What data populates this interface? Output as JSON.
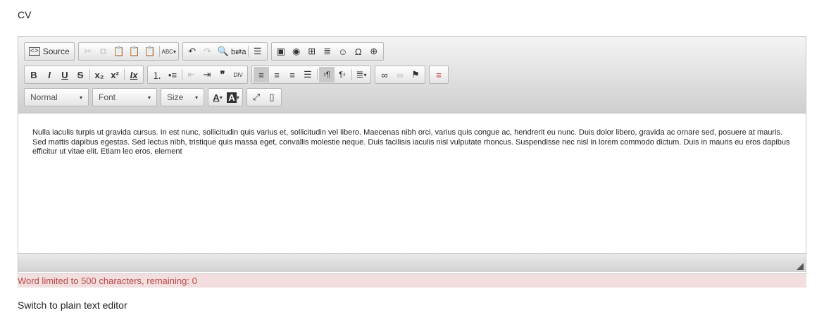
{
  "field_label": "CV",
  "toolbar": {
    "source_label": "Source",
    "style_combo": "Normal",
    "font_combo": "Font",
    "size_combo": "Size",
    "spell_label": "ABC",
    "div_label": "DIV"
  },
  "editor_text": "Nulla iaculis turpis ut gravida cursus. In est nunc, sollicitudin quis varius et, sollicitudin vel libero. Maecenas nibh orci, varius quis congue ac, hendrerit eu nunc. Duis dolor libero, gravida ac ornare sed, posuere at mauris. Sed mattis dapibus egestas. Sed lectus nibh, tristique quis massa eget, convallis molestie neque. Duis facilisis iaculis nisl vulputate rhoncus. Suspendisse nec nisl in lorem commodo dictum. Duis in mauris eu eros dapibus efficitur ut vitae elit. Etiam leo eros, element",
  "limit_message": "Word limited to 500 characters, remaining: 0",
  "switch_link": "Switch to plain text editor",
  "colors": {
    "alert_bg": "#f2dede",
    "alert_text": "#b94a48",
    "toolbar_top": "#f4f4f4",
    "toolbar_bottom": "#cfcfcf"
  }
}
